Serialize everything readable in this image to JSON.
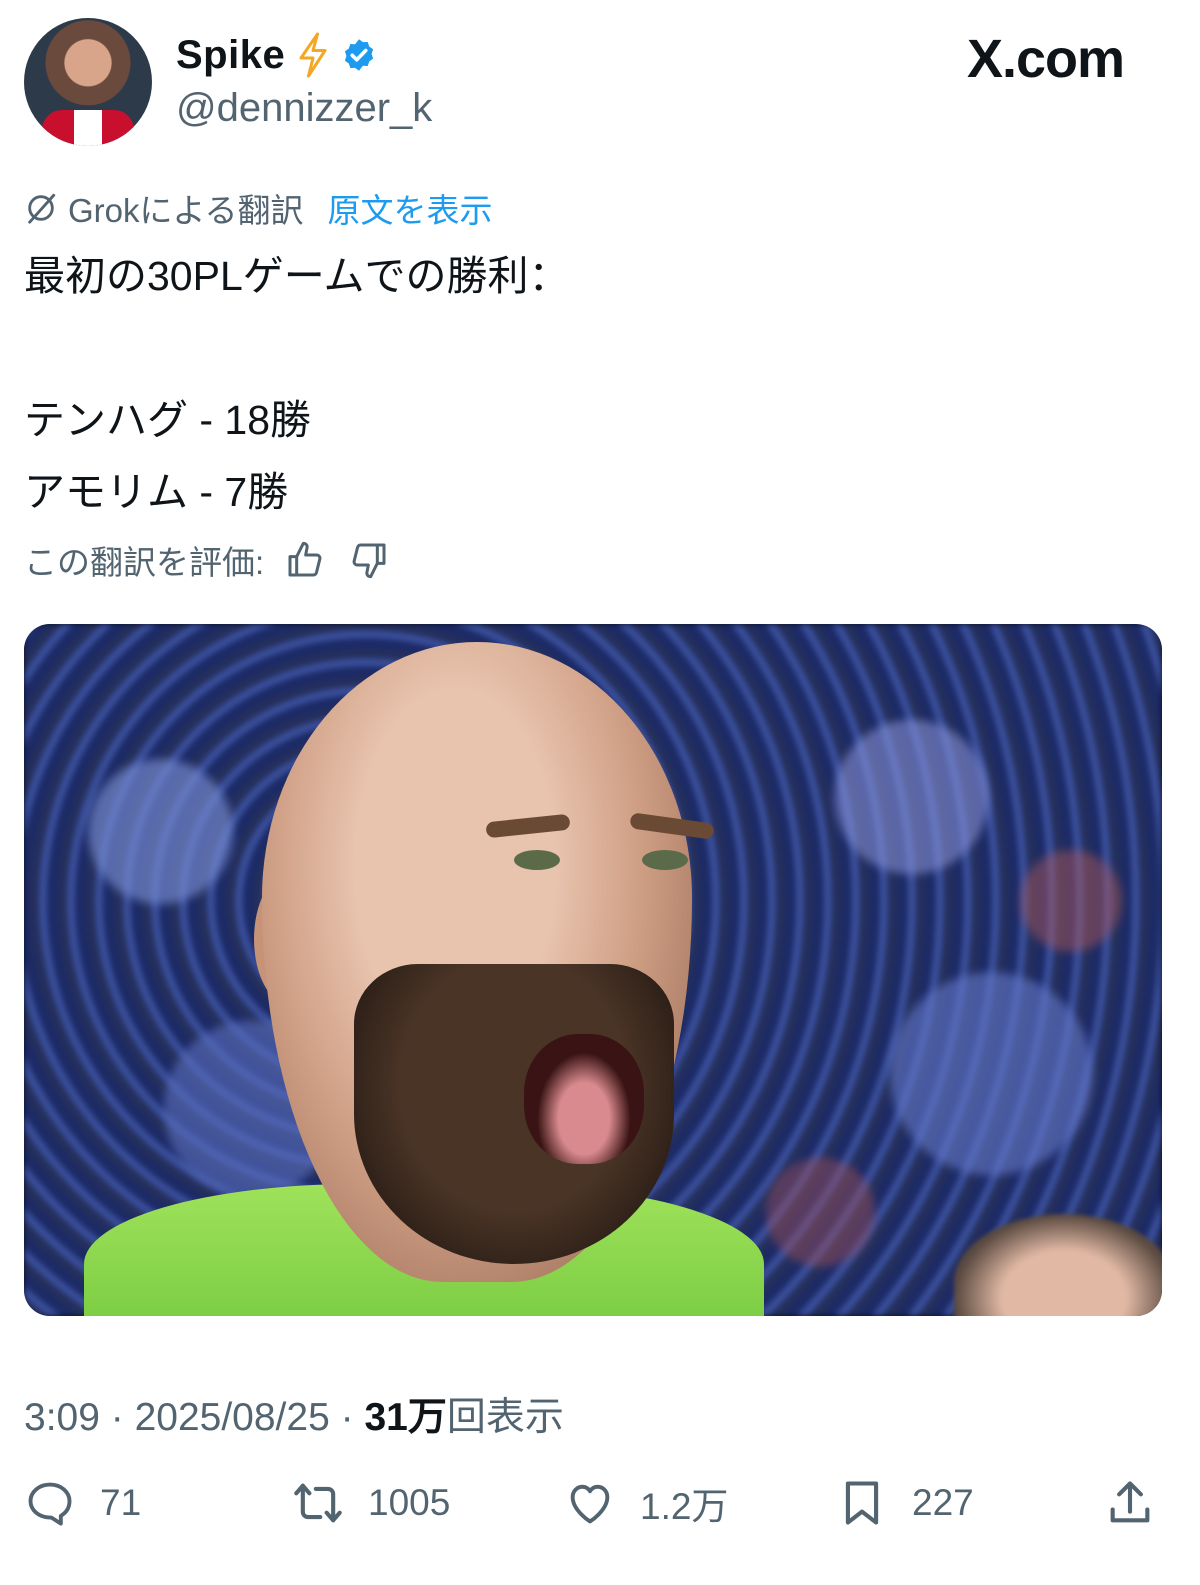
{
  "author": {
    "name": "Spike",
    "emoji": "⚡",
    "handle": "@dennizzer_k",
    "verified": true
  },
  "site_label": "X.com",
  "translation": {
    "label": "Grokによる翻訳",
    "show_original": "原文を表示",
    "rate_label": "この翻訳を評価:"
  },
  "tweet": {
    "lines": [
      "最初の30PLゲームでの勝利：",
      "",
      "テンハグ - 18勝",
      "アモリム - 7勝"
    ]
  },
  "meta": {
    "time": "3:09",
    "sep1": " · ",
    "date": "2025/08/25",
    "sep2": " · ",
    "views_count": "31万",
    "views_label": "回表示"
  },
  "actions": {
    "replies": "71",
    "retweets": "1005",
    "likes": "1.2万",
    "bookmarks": "227"
  },
  "colors": {
    "accent": "#1d9bf0",
    "text": "#0f1419",
    "secondary": "#536471"
  }
}
